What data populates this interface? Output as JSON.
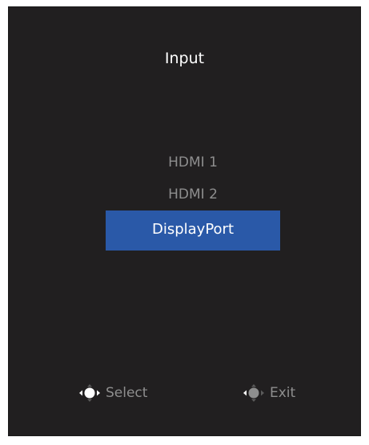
{
  "osd": {
    "title": "Input",
    "options": [
      {
        "label": "HDMI 1",
        "selected": false
      },
      {
        "label": "HDMI 2",
        "selected": false
      },
      {
        "label": "DisplayPort",
        "selected": true
      }
    ],
    "hints": {
      "select_label": "Select",
      "select_icon": "joystick-left-right-icon",
      "exit_label": "Exit",
      "exit_icon": "joystick-left-icon"
    },
    "colors": {
      "panel_background": "#211f20",
      "selected_highlight": "#2a59a8",
      "selected_text": "#ffffff",
      "unselected_text": "#8e8e8e",
      "title_text": "#ffffff"
    }
  }
}
